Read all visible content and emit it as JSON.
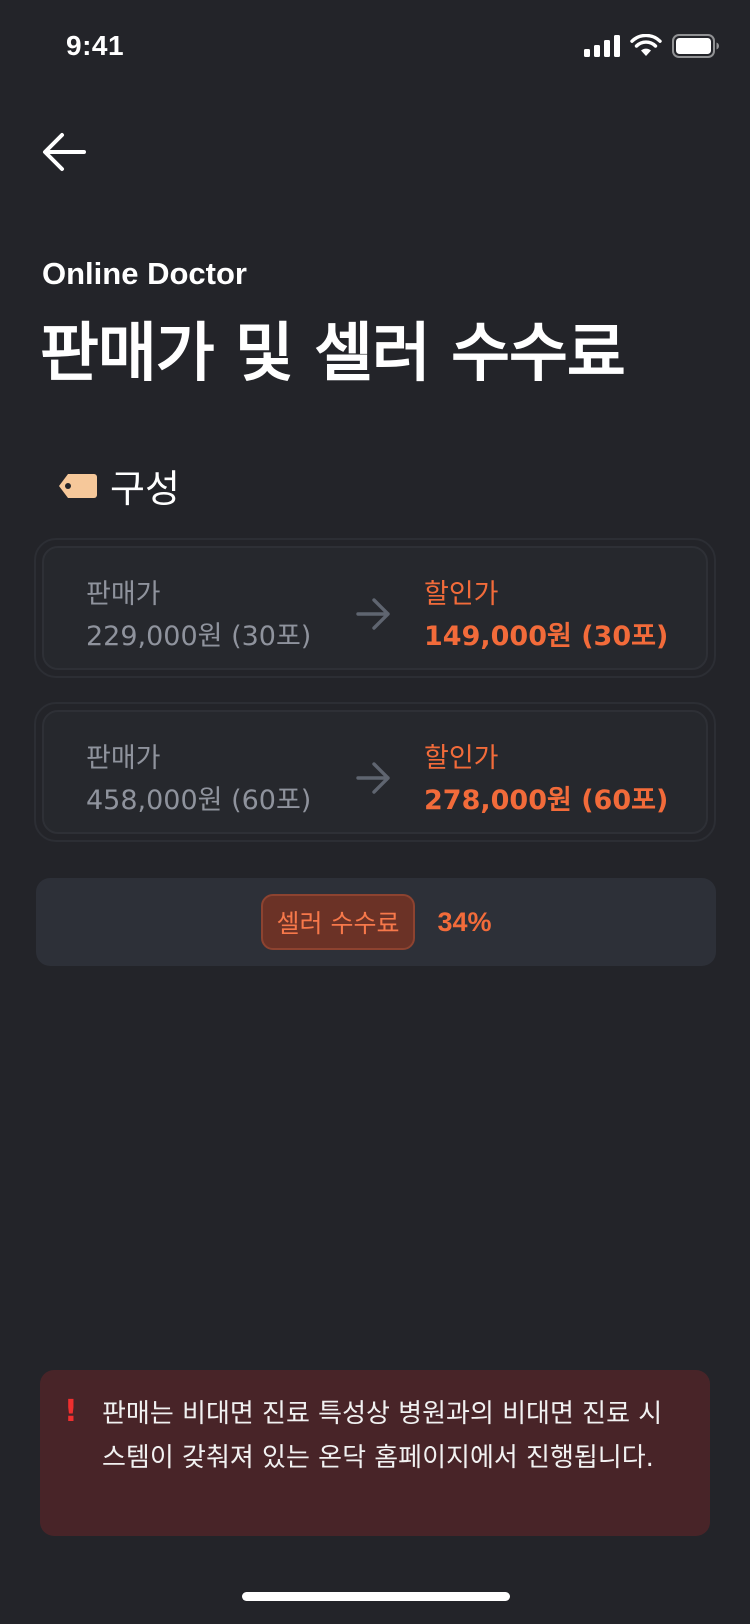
{
  "status_bar": {
    "time": "9:41"
  },
  "header": {
    "subtitle": "Online Doctor",
    "title": "판매가 및 셀러 수수료"
  },
  "section": {
    "label": "구성",
    "icon": "price-tag-icon"
  },
  "price_rows": [
    {
      "original_label": "판매가",
      "original_price": "229,000원 (30포)",
      "discount_label": "할인가",
      "discount_price": "149,000원 (30포)"
    },
    {
      "original_label": "판매가",
      "original_price": "458,000원 (60포)",
      "discount_label": "할인가",
      "discount_price": "278,000원 (60포)"
    }
  ],
  "fee": {
    "label": "셀러 수수료",
    "value": "34%"
  },
  "notice": {
    "icon": "!",
    "text": "판매는 비대면 진료 특성상 병원과의 비대면 진료 시스템이 갖춰져 있는 온닥 홈페이지에서 진행됩니다."
  },
  "colors": {
    "background": "#232429",
    "accent": "#f26b3a",
    "muted": "#8f939d",
    "notice_bg": "#482428"
  }
}
